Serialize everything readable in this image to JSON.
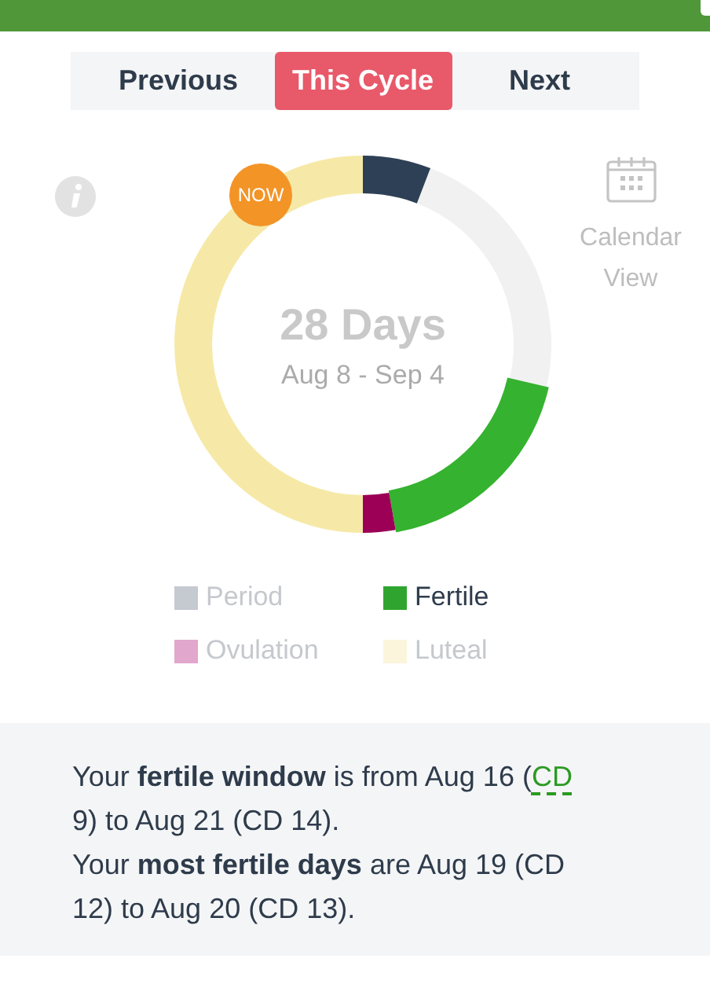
{
  "tabs": [
    {
      "label": "Previous",
      "selected": false
    },
    {
      "label": "This Cycle",
      "selected": true
    },
    {
      "label": "Next",
      "selected": false
    }
  ],
  "ring": {
    "badge": "NOW",
    "title": "28 Days",
    "dates": "Aug 8 - Sep 4"
  },
  "calendar_link": {
    "label": "Calendar View"
  },
  "legend": [
    {
      "label": "Period",
      "color": "#c5c9d0",
      "active": false
    },
    {
      "label": "Fertile",
      "color": "#2fa52f",
      "active": true
    },
    {
      "label": "Ovulation",
      "color": "#e2a7cc",
      "active": false
    },
    {
      "label": "Luteal",
      "color": "#fbf5dc",
      "active": false
    }
  ],
  "summary": [
    {
      "before": "Your **fertile window** is from Aug 16 (",
      "link": "CD",
      "after": " 9) to Aug 21 (CD 14)."
    },
    {
      "before": "Your **most fertile days** are Aug 19 (CD 12) to Aug 20 (CD 13)."
    }
  ]
}
